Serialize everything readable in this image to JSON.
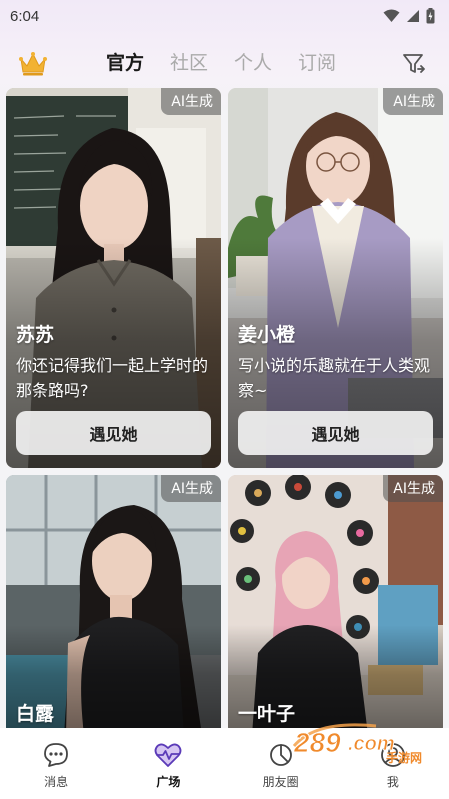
{
  "status_bar": {
    "time": "6:04",
    "icons": [
      "wifi-icon",
      "signal-icon",
      "battery-charging-icon"
    ]
  },
  "header": {
    "crown_icon": "crown-icon",
    "tabs": [
      {
        "label": "官方",
        "active": true
      },
      {
        "label": "社区",
        "active": false
      },
      {
        "label": "个人",
        "active": false
      },
      {
        "label": "订阅",
        "active": false
      }
    ],
    "filter_icon": "filter-icon"
  },
  "cards": [
    {
      "badge": "AI生成",
      "name": "苏苏",
      "description": "你还记得我们一起上学时的那条路吗?",
      "button": "遇见她",
      "scene": "classroom"
    },
    {
      "badge": "AI生成",
      "name": "姜小橙",
      "description": "写小说的乐趣就在于人类观察~",
      "button": "遇见她",
      "scene": "study"
    },
    {
      "badge": "AI生成",
      "name": "白露",
      "description": "",
      "button": "",
      "scene": "poolside"
    },
    {
      "badge": "AI生成",
      "name": "一叶子",
      "description": "",
      "button": "",
      "scene": "records-room"
    }
  ],
  "bottom_nav": [
    {
      "label": "消息",
      "icon": "message-icon",
      "active": false
    },
    {
      "label": "广场",
      "icon": "heart-icon",
      "active": true
    },
    {
      "label": "朋友圈",
      "icon": "friends-circle-icon",
      "active": false
    },
    {
      "label": "我",
      "icon": "profile-icon",
      "active": false
    }
  ],
  "colors": {
    "accent": "#7b4fd6",
    "crown": "#f2b233",
    "watermark": "#f08a2c"
  },
  "watermark": {
    "text": "289.com",
    "subtext": "手游网"
  }
}
